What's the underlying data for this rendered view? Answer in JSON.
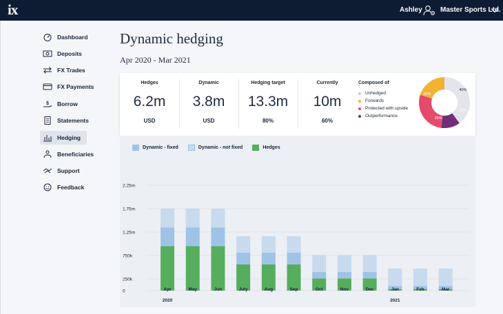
{
  "app": {
    "logo": "ix",
    "user_name": "Ashley",
    "company": "Master Sports Ltd."
  },
  "nav": {
    "items": [
      {
        "label": "Dashboard",
        "icon": "gauge-icon",
        "active": false
      },
      {
        "label": "Deposits",
        "icon": "banknote-icon",
        "active": false
      },
      {
        "label": "FX Trades",
        "icon": "exchange-arrows-icon",
        "active": false
      },
      {
        "label": "FX Payments",
        "icon": "card-icon",
        "active": false
      },
      {
        "label": "Borrow",
        "icon": "hand-dollar-icon",
        "active": false
      },
      {
        "label": "Statements",
        "icon": "document-icon",
        "active": false
      },
      {
        "label": "Hedging",
        "icon": "bar-chart-icon",
        "active": true
      },
      {
        "label": "Beneficiaries",
        "icon": "people-icon",
        "active": false
      },
      {
        "label": "Support",
        "icon": "handshake-icon",
        "active": false
      },
      {
        "label": "Feedback",
        "icon": "smiley-icon",
        "active": false
      }
    ]
  },
  "page": {
    "title": "Dynamic hedging",
    "period": "Apr 2020 - Mar 2021"
  },
  "summary": {
    "hedges": {
      "label": "Hedges",
      "value": "6.2m",
      "unit": "USD"
    },
    "dynamic": {
      "label": "Dynamic",
      "value": "3.8m",
      "unit": "USD"
    },
    "target": {
      "label": "Hedging target",
      "value": "13.3m",
      "unit": "80%"
    },
    "currently": {
      "label": "Currently",
      "value": "10m",
      "unit": "60%"
    },
    "composition": {
      "title": "Composed of",
      "items": [
        {
          "label": "Unhedged",
          "color": "#e2e5ea",
          "percent": 40
        },
        {
          "label": "Forwards",
          "color": "#f2b233",
          "percent": 20
        },
        {
          "label": "Protected with upside",
          "color": "#e5496c",
          "percent": 28
        },
        {
          "label": "Outperformance",
          "color": "#6f2d7a",
          "percent": 12
        }
      ],
      "slice_labels": [
        "40%",
        "20%",
        "28%",
        "12%"
      ]
    }
  },
  "colors": {
    "dynamic_fixed": "#9fc3e7",
    "dynamic_not_fixed": "#c7daee",
    "hedges": "#56ad5e"
  },
  "chart_data": {
    "type": "bar",
    "stacked": true,
    "categories": [
      "Apr",
      "May",
      "Jun",
      "July",
      "Aug",
      "Sep",
      "Oct",
      "Nov",
      "Dec",
      "Jan",
      "Feb",
      "Mar"
    ],
    "year_labels": {
      "Apr": "2020",
      "Jan": "2021"
    },
    "y_ticks": [
      "2.25m",
      "1.75m",
      "1.25m",
      "750k",
      "250k",
      "0"
    ],
    "y_tick_values": [
      2250000,
      1750000,
      1250000,
      750000,
      250000,
      0
    ],
    "grid": true,
    "legend": "top-left",
    "series": [
      {
        "name": "Hedges",
        "values": [
          950000,
          950000,
          950000,
          560000,
          560000,
          560000,
          260000,
          260000,
          260000,
          30000,
          30000,
          30000
        ]
      },
      {
        "name": "Dynamic - fixed",
        "values": [
          400000,
          400000,
          400000,
          250000,
          250000,
          250000,
          140000,
          140000,
          140000,
          70000,
          70000,
          70000
        ]
      },
      {
        "name": "Dynamic - not fixed",
        "values": [
          400000,
          400000,
          400000,
          350000,
          350000,
          350000,
          360000,
          360000,
          360000,
          370000,
          370000,
          370000
        ]
      }
    ]
  }
}
